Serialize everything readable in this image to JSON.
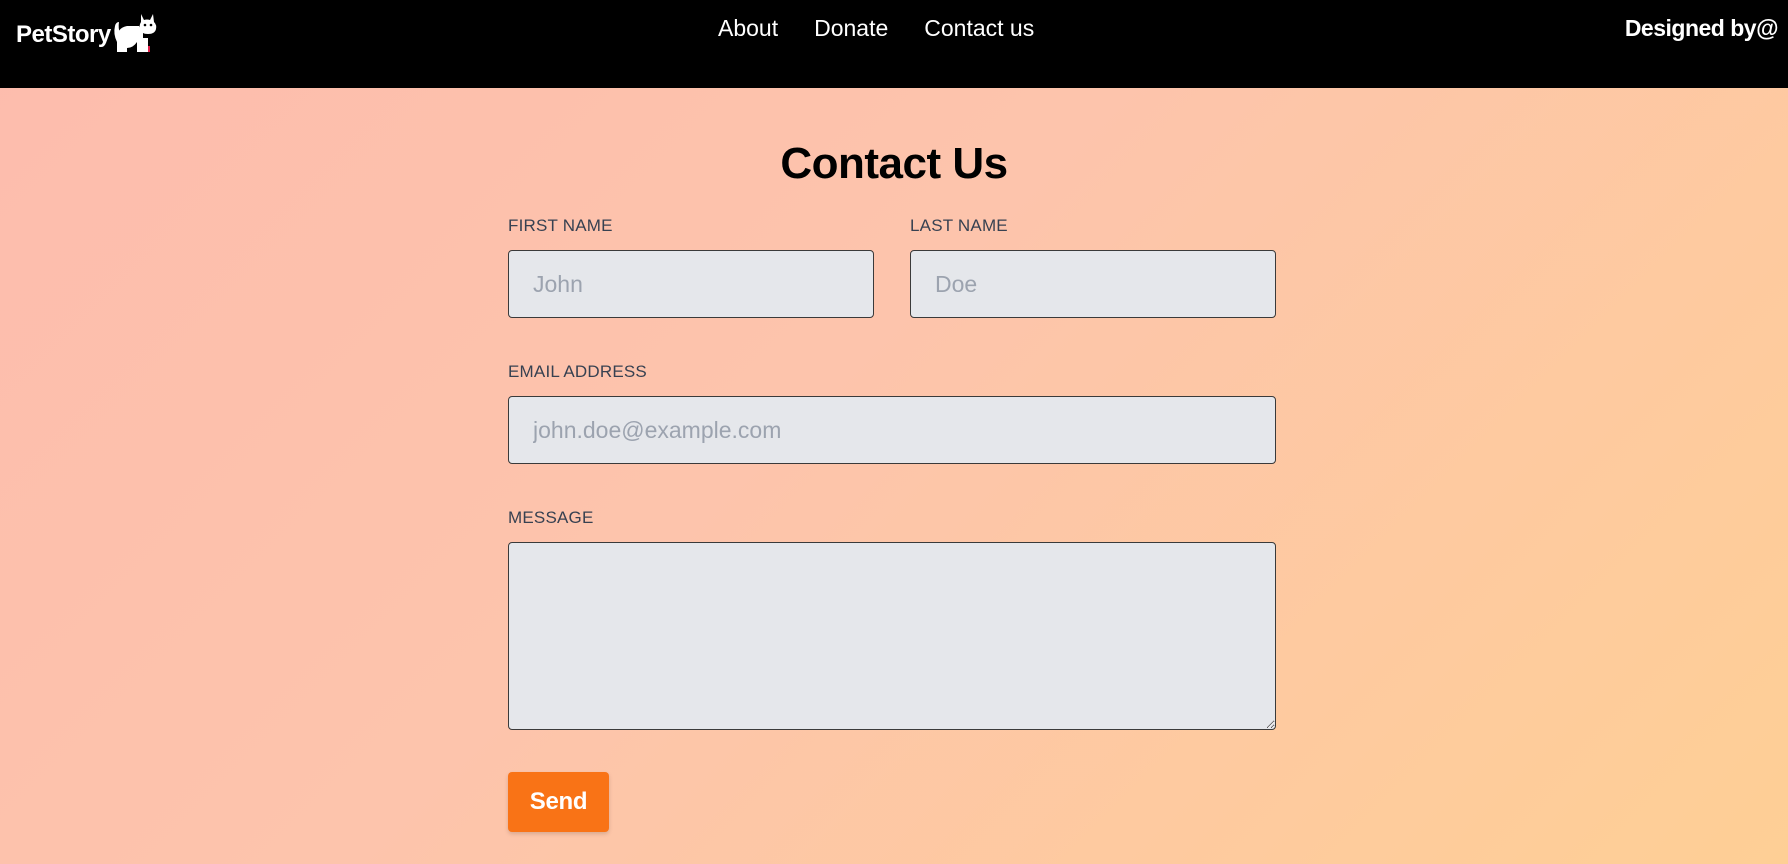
{
  "navbar": {
    "brand": "PetStory",
    "brand_icon": "cat-icon",
    "links": [
      {
        "label": "About"
      },
      {
        "label": "Donate"
      },
      {
        "label": "Contact us"
      }
    ],
    "designed_by": "Designed by@"
  },
  "page": {
    "title": "Contact Us"
  },
  "form": {
    "first_name": {
      "label": "FIRST NAME",
      "placeholder": "John",
      "value": ""
    },
    "last_name": {
      "label": "LAST NAME",
      "placeholder": "Doe",
      "value": ""
    },
    "email": {
      "label": "EMAIL ADDRESS",
      "placeholder": "john.doe@example.com",
      "value": ""
    },
    "message": {
      "label": "MESSAGE",
      "placeholder": "",
      "value": ""
    },
    "send_label": "Send"
  },
  "colors": {
    "navbar_bg": "#000000",
    "send_button": "#f97316",
    "input_bg": "#e5e7eb",
    "gradient_start": "#fdbcad",
    "gradient_end": "#fecf95"
  }
}
